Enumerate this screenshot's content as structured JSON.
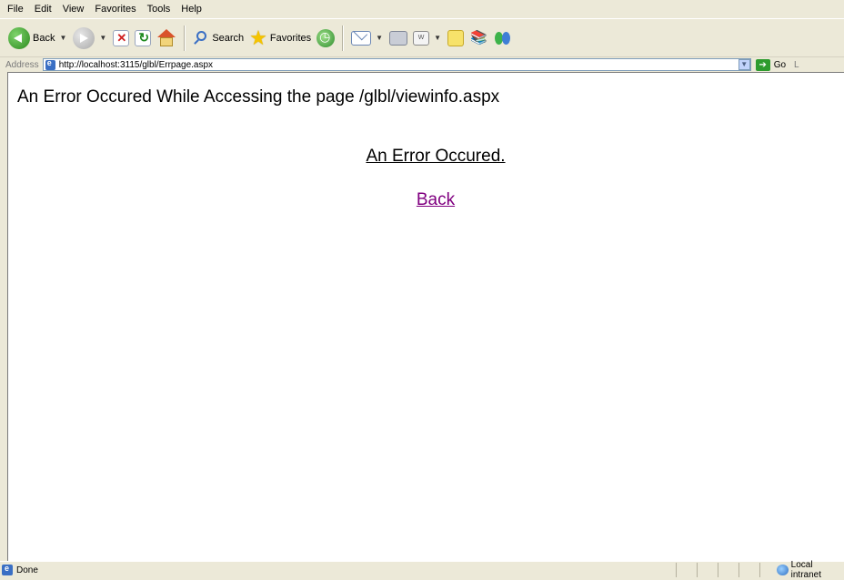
{
  "menu": [
    "File",
    "Edit",
    "View",
    "Favorites",
    "Tools",
    "Help"
  ],
  "toolbar": {
    "back_label": "Back",
    "search_label": "Search",
    "favorites_label": "Favorites"
  },
  "address": {
    "label": "Address",
    "url": "http://localhost:3115/glbl/Errpage.aspx",
    "go_label": "Go",
    "links_cut": "L"
  },
  "page": {
    "heading": "An Error Occured While Accessing the page /glbl/viewinfo.aspx",
    "message": "An Error Occured.",
    "back_link": "Back"
  },
  "status": {
    "text": "Done",
    "zone": "Local intranet"
  }
}
